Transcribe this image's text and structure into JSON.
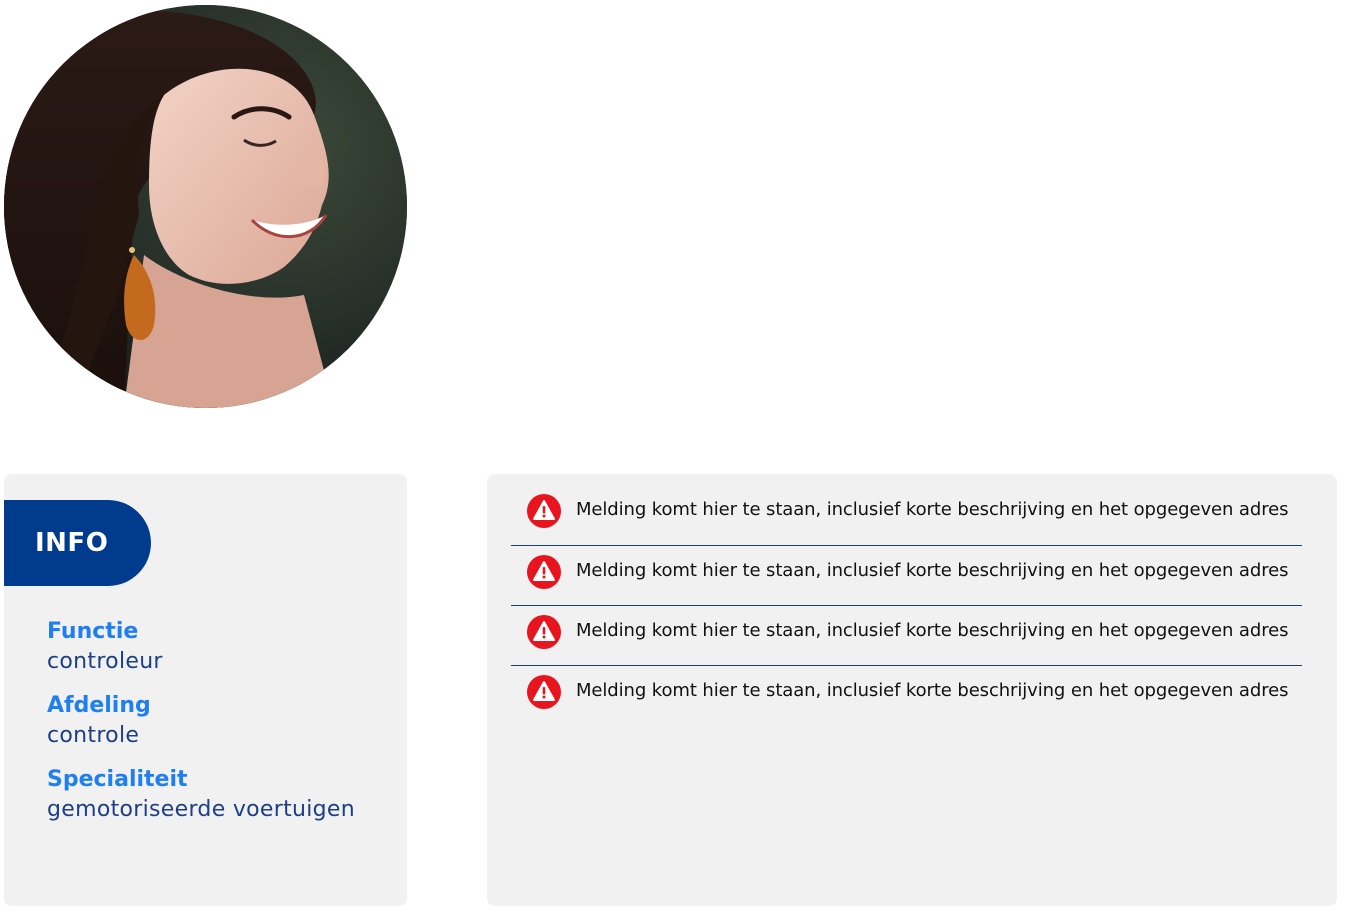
{
  "profile": {
    "avatar_icon": "profile-photo"
  },
  "info": {
    "tab_label": "INFO",
    "fields": [
      {
        "label": "Functie",
        "value": "controleur"
      },
      {
        "label": "Afdeling",
        "value": "controle"
      },
      {
        "label": "Specialiteit",
        "value": "gemotoriseerde voertuigen"
      }
    ]
  },
  "notifications": {
    "icon": "warning-icon",
    "icon_color": "#e8141e",
    "items": [
      {
        "text": "Melding komt hier te staan, inclusief korte beschrijving en het opgegeven adres"
      },
      {
        "text": "Melding komt hier te staan, inclusief korte beschrijving en het opgegeven adres"
      },
      {
        "text": "Melding komt hier te staan, inclusief korte beschrijving en het opgegeven adres"
      },
      {
        "text": "Melding komt hier te staan, inclusief korte beschrijving en het opgegeven adres"
      }
    ]
  },
  "colors": {
    "brand_blue": "#003b8e",
    "label_blue": "#1f7ff0",
    "value_blue": "#1c3f86",
    "card_bg": "#f1f1f2"
  }
}
